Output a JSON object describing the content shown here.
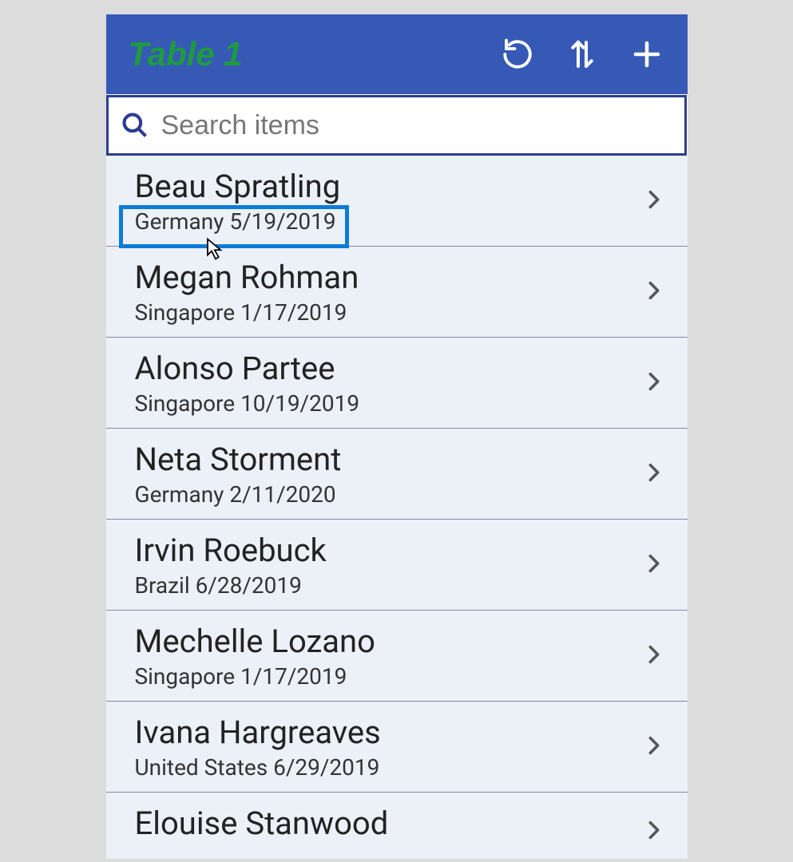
{
  "header": {
    "title": "Table 1"
  },
  "search": {
    "placeholder": "Search items"
  },
  "items": [
    {
      "name": "Beau Spratling",
      "sub": "Germany 5/19/2019"
    },
    {
      "name": "Megan Rohman",
      "sub": "Singapore 1/17/2019"
    },
    {
      "name": "Alonso Partee",
      "sub": "Singapore 10/19/2019"
    },
    {
      "name": "Neta Storment",
      "sub": "Germany 2/11/2020"
    },
    {
      "name": "Irvin Roebuck",
      "sub": "Brazil 6/28/2019"
    },
    {
      "name": "Mechelle Lozano",
      "sub": "Singapore 1/17/2019"
    },
    {
      "name": "Ivana Hargreaves",
      "sub": "United States 6/29/2019"
    },
    {
      "name": "Elouise Stanwood",
      "sub": ""
    }
  ]
}
